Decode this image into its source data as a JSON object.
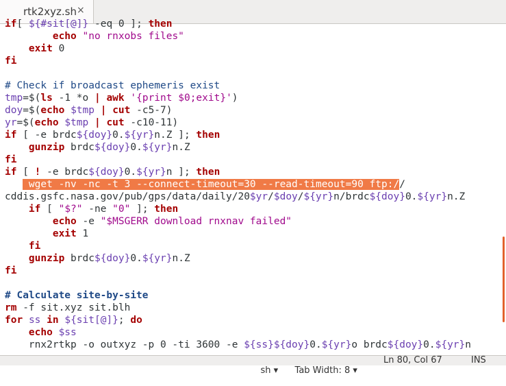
{
  "tab": {
    "title": "rtk2xyz.sh",
    "close": "×"
  },
  "editor": {
    "lines": [
      [
        [
          "kw",
          "if"
        ],
        [
          "",
          "[ "
        ],
        [
          "vr",
          "${#sit[@]}"
        ],
        [
          "",
          " -eq 0 ]; "
        ],
        [
          "kw",
          "then"
        ]
      ],
      [
        [
          "",
          "        "
        ],
        [
          "kw",
          "echo"
        ],
        [
          "",
          " "
        ],
        [
          "st",
          "\"no rnxobs files\""
        ]
      ],
      [
        [
          "",
          "    "
        ],
        [
          "kw",
          "exit"
        ],
        [
          "",
          " 0"
        ]
      ],
      [
        [
          "kw",
          "fi"
        ]
      ],
      [
        [
          "",
          ""
        ]
      ],
      [
        [
          "cm",
          "# Check if broadcast ephemeris exist"
        ]
      ],
      [
        [
          "vr",
          "tmp"
        ],
        [
          "",
          "=$("
        ],
        [
          "kw",
          "ls"
        ],
        [
          "",
          " -1 *o "
        ],
        [
          "kw",
          "|"
        ],
        [
          "",
          " "
        ],
        [
          "kw",
          "awk"
        ],
        [
          "",
          " "
        ],
        [
          "st",
          "'{print $0;exit}'"
        ],
        [
          "",
          ")"
        ]
      ],
      [
        [
          "vr",
          "doy"
        ],
        [
          "",
          "=$("
        ],
        [
          "kw",
          "echo"
        ],
        [
          "",
          " "
        ],
        [
          "vr",
          "$tmp"
        ],
        [
          "",
          " "
        ],
        [
          "kw",
          "|"
        ],
        [
          "",
          " "
        ],
        [
          "kw",
          "cut"
        ],
        [
          "",
          " -c5-7)"
        ]
      ],
      [
        [
          "vr",
          "yr"
        ],
        [
          "",
          "=$("
        ],
        [
          "kw",
          "echo"
        ],
        [
          "",
          " "
        ],
        [
          "vr",
          "$tmp"
        ],
        [
          "",
          " "
        ],
        [
          "kw",
          "|"
        ],
        [
          "",
          " "
        ],
        [
          "kw",
          "cut"
        ],
        [
          "",
          " -c10-11)"
        ]
      ],
      [
        [
          "kw",
          "if"
        ],
        [
          "",
          " [ -e brdc"
        ],
        [
          "vr",
          "${doy}"
        ],
        [
          "",
          "0."
        ],
        [
          "vr",
          "${yr}"
        ],
        [
          "",
          "n.Z ]; "
        ],
        [
          "kw",
          "then"
        ]
      ],
      [
        [
          "",
          "    "
        ],
        [
          "kw",
          "gunzip"
        ],
        [
          "",
          " brdc"
        ],
        [
          "vr",
          "${doy}"
        ],
        [
          "",
          "0."
        ],
        [
          "vr",
          "${yr}"
        ],
        [
          "",
          "n.Z"
        ]
      ],
      [
        [
          "kw",
          "fi"
        ]
      ],
      [
        [
          "kw",
          "if"
        ],
        [
          "",
          " [ "
        ],
        [
          "kw",
          "!"
        ],
        [
          "",
          " -e brdc"
        ],
        [
          "vr",
          "${doy}"
        ],
        [
          "",
          "0."
        ],
        [
          "vr",
          "${yr}"
        ],
        [
          "",
          "n ]; "
        ],
        [
          "kw",
          "then"
        ]
      ],
      [
        [
          "",
          "   "
        ],
        [
          "sel",
          " wget -nv -nc -t 3 --connect-timeout=30 --read-timeout=90 ftp:/"
        ],
        [
          "",
          "/"
        ]
      ],
      [
        [
          "",
          "cddis.gsfc.nasa.gov/pub/gps/data/daily/20"
        ],
        [
          "vr",
          "$yr"
        ],
        [
          "",
          "/"
        ],
        [
          "vr",
          "$doy"
        ],
        [
          "",
          "/"
        ],
        [
          "vr",
          "${yr}"
        ],
        [
          "",
          "n/brdc"
        ],
        [
          "vr",
          "${doy}"
        ],
        [
          "",
          "0."
        ],
        [
          "vr",
          "${yr}"
        ],
        [
          "",
          "n.Z"
        ]
      ],
      [
        [
          "",
          "    "
        ],
        [
          "kw",
          "if"
        ],
        [
          "",
          " [ "
        ],
        [
          "st",
          "\"$?\""
        ],
        [
          "",
          " -ne "
        ],
        [
          "st",
          "\"0\""
        ],
        [
          "",
          " ]; "
        ],
        [
          "kw",
          "then"
        ]
      ],
      [
        [
          "",
          "        "
        ],
        [
          "kw",
          "echo"
        ],
        [
          "",
          " -e "
        ],
        [
          "st",
          "\"$MSGERR download rnxnav failed\""
        ]
      ],
      [
        [
          "",
          "        "
        ],
        [
          "kw",
          "exit"
        ],
        [
          "",
          " 1"
        ]
      ],
      [
        [
          "",
          "    "
        ],
        [
          "kw",
          "fi"
        ]
      ],
      [
        [
          "",
          "    "
        ],
        [
          "kw",
          "gunzip"
        ],
        [
          "",
          " brdc"
        ],
        [
          "vr",
          "${doy}"
        ],
        [
          "",
          "0."
        ],
        [
          "vr",
          "${yr}"
        ],
        [
          "",
          "n.Z"
        ]
      ],
      [
        [
          "kw",
          "fi"
        ]
      ],
      [
        [
          "",
          ""
        ]
      ],
      [
        [
          "cmb",
          "# Calculate site-by-site"
        ]
      ],
      [
        [
          "kw",
          "rm"
        ],
        [
          "",
          " -f sit.xyz sit.blh"
        ]
      ],
      [
        [
          "kw",
          "for"
        ],
        [
          "",
          " "
        ],
        [
          "vr",
          "ss"
        ],
        [
          "",
          " "
        ],
        [
          "kw",
          "in"
        ],
        [
          "",
          " "
        ],
        [
          "vr",
          "${sit[@]}"
        ],
        [
          "",
          "; "
        ],
        [
          "kw",
          "do"
        ]
      ],
      [
        [
          "",
          "    "
        ],
        [
          "kw",
          "echo"
        ],
        [
          "",
          " "
        ],
        [
          "vr",
          "$ss"
        ]
      ],
      [
        [
          "",
          "    rnx2rtkp -o outxyz -p 0 -ti 3600 -e "
        ],
        [
          "vr",
          "${ss}${doy}"
        ],
        [
          "",
          "0."
        ],
        [
          "vr",
          "${yr}"
        ],
        [
          "",
          "o brdc"
        ],
        [
          "vr",
          "${doy}"
        ],
        [
          "",
          "0."
        ],
        [
          "vr",
          "${yr}"
        ],
        [
          "",
          "n"
        ]
      ]
    ]
  },
  "status": {
    "language": "sh",
    "tab_width": "Tab Width: 8",
    "cursor": "Ln 80, Col 67",
    "mode": "INS"
  }
}
